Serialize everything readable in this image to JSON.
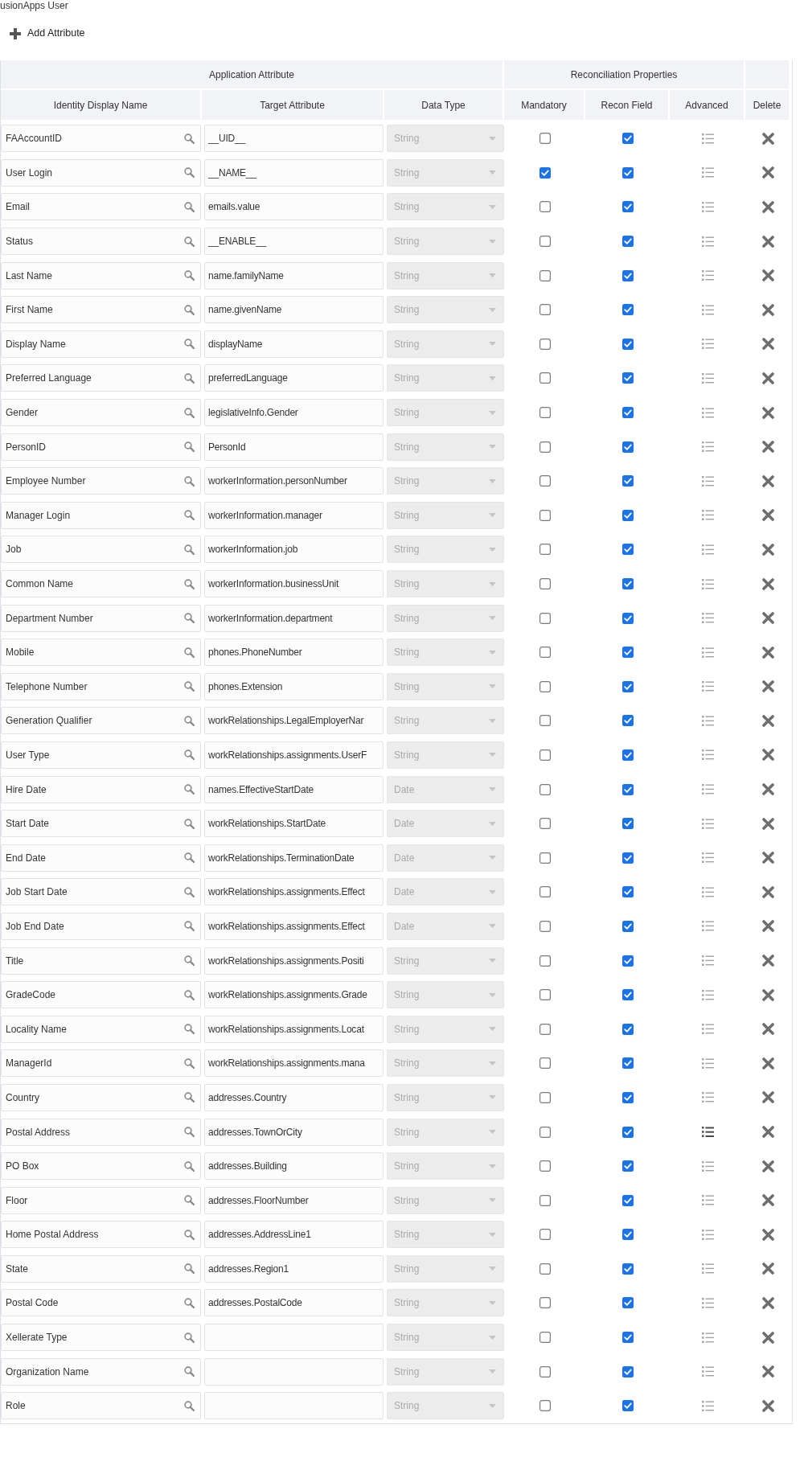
{
  "page": {
    "title": "usionApps User"
  },
  "toolbar": {
    "add_button": {
      "label": "Add Attribute"
    }
  },
  "table": {
    "groups": [
      {
        "label": "Application Attribute",
        "columns": [
          "Identity Display Name",
          "Target Attribute",
          "Data Type"
        ]
      },
      {
        "label": "Reconciliation Properties",
        "columns": [
          "Mandatory",
          "Recon Field",
          "Advanced"
        ]
      },
      {
        "columns": [
          "Delete"
        ]
      }
    ],
    "rows": [
      {
        "display_name": "FAAccountID",
        "target": "__UID__",
        "data_type": "String",
        "data_type_disabled": true,
        "mandatory": false,
        "recon_field": true,
        "advanced_highlighted": false
      },
      {
        "display_name": "User Login",
        "target": "__NAME__",
        "data_type": "String",
        "data_type_disabled": true,
        "mandatory": true,
        "recon_field": true,
        "advanced_highlighted": false
      },
      {
        "display_name": "Email",
        "target": "emails.value",
        "data_type": "String",
        "data_type_disabled": true,
        "mandatory": false,
        "recon_field": true,
        "advanced_highlighted": false
      },
      {
        "display_name": "Status",
        "target": "__ENABLE__",
        "data_type": "String",
        "data_type_disabled": true,
        "mandatory": false,
        "recon_field": true,
        "advanced_highlighted": false
      },
      {
        "display_name": "Last Name",
        "target": "name.familyName",
        "data_type": "String",
        "data_type_disabled": true,
        "mandatory": false,
        "recon_field": true,
        "advanced_highlighted": false
      },
      {
        "display_name": "First Name",
        "target": "name.givenName",
        "data_type": "String",
        "data_type_disabled": true,
        "mandatory": false,
        "recon_field": true,
        "advanced_highlighted": false
      },
      {
        "display_name": "Display Name",
        "target": "displayName",
        "data_type": "String",
        "data_type_disabled": true,
        "mandatory": false,
        "recon_field": true,
        "advanced_highlighted": false
      },
      {
        "display_name": "Preferred Language",
        "target": "preferredLanguage",
        "data_type": "String",
        "data_type_disabled": true,
        "mandatory": false,
        "recon_field": true,
        "advanced_highlighted": false
      },
      {
        "display_name": "Gender",
        "target": "legislativeInfo.Gender",
        "data_type": "String",
        "data_type_disabled": true,
        "mandatory": false,
        "recon_field": true,
        "advanced_highlighted": false
      },
      {
        "display_name": "PersonID",
        "target": "PersonId",
        "data_type": "String",
        "data_type_disabled": true,
        "mandatory": false,
        "recon_field": true,
        "advanced_highlighted": false
      },
      {
        "display_name": "Employee Number",
        "target": "workerInformation.personNumber",
        "data_type": "String",
        "data_type_disabled": true,
        "mandatory": false,
        "recon_field": true,
        "advanced_highlighted": false
      },
      {
        "display_name": "Manager Login",
        "target": "workerInformation.manager",
        "data_type": "String",
        "data_type_disabled": true,
        "mandatory": false,
        "recon_field": true,
        "advanced_highlighted": false
      },
      {
        "display_name": "Job",
        "target": "workerInformation.job",
        "data_type": "String",
        "data_type_disabled": true,
        "mandatory": false,
        "recon_field": true,
        "advanced_highlighted": false
      },
      {
        "display_name": "Common Name",
        "target": "workerInformation.businessUnit",
        "data_type": "String",
        "data_type_disabled": true,
        "mandatory": false,
        "recon_field": true,
        "advanced_highlighted": false
      },
      {
        "display_name": "Department Number",
        "target": "workerInformation.department",
        "data_type": "String",
        "data_type_disabled": true,
        "mandatory": false,
        "recon_field": true,
        "advanced_highlighted": false
      },
      {
        "display_name": "Mobile",
        "target": "phones.PhoneNumber",
        "data_type": "String",
        "data_type_disabled": true,
        "mandatory": false,
        "recon_field": true,
        "advanced_highlighted": false
      },
      {
        "display_name": "Telephone Number",
        "target": "phones.Extension",
        "data_type": "String",
        "data_type_disabled": true,
        "mandatory": false,
        "recon_field": true,
        "advanced_highlighted": false
      },
      {
        "display_name": "Generation Qualifier",
        "target": "workRelationships.LegalEmployerNar",
        "data_type": "String",
        "data_type_disabled": true,
        "mandatory": false,
        "recon_field": true,
        "advanced_highlighted": false
      },
      {
        "display_name": "User Type",
        "target": "workRelationships.assignments.UserF",
        "data_type": "String",
        "data_type_disabled": true,
        "mandatory": false,
        "recon_field": true,
        "advanced_highlighted": false
      },
      {
        "display_name": "Hire Date",
        "target": "names.EffectiveStartDate",
        "data_type": "Date",
        "data_type_disabled": true,
        "mandatory": false,
        "recon_field": true,
        "advanced_highlighted": false
      },
      {
        "display_name": "Start Date",
        "target": "workRelationships.StartDate",
        "data_type": "Date",
        "data_type_disabled": true,
        "mandatory": false,
        "recon_field": true,
        "advanced_highlighted": false
      },
      {
        "display_name": "End Date",
        "target": "workRelationships.TerminationDate",
        "data_type": "Date",
        "data_type_disabled": true,
        "mandatory": false,
        "recon_field": true,
        "advanced_highlighted": false
      },
      {
        "display_name": "Job Start Date",
        "target": "workRelationships.assignments.Effect",
        "data_type": "Date",
        "data_type_disabled": true,
        "mandatory": false,
        "recon_field": true,
        "advanced_highlighted": false
      },
      {
        "display_name": "Job End Date",
        "target": "workRelationships.assignments.Effect",
        "data_type": "Date",
        "data_type_disabled": true,
        "mandatory": false,
        "recon_field": true,
        "advanced_highlighted": false
      },
      {
        "display_name": "Title",
        "target": "workRelationships.assignments.Positi",
        "data_type": "String",
        "data_type_disabled": true,
        "mandatory": false,
        "recon_field": true,
        "advanced_highlighted": false
      },
      {
        "display_name": "GradeCode",
        "target": "workRelationships.assignments.Grade",
        "data_type": "String",
        "data_type_disabled": true,
        "mandatory": false,
        "recon_field": true,
        "advanced_highlighted": false
      },
      {
        "display_name": "Locality Name",
        "target": "workRelationships.assignments.Locat",
        "data_type": "String",
        "data_type_disabled": true,
        "mandatory": false,
        "recon_field": true,
        "advanced_highlighted": false
      },
      {
        "display_name": "ManagerId",
        "target": "workRelationships.assignments.mana",
        "data_type": "String",
        "data_type_disabled": true,
        "mandatory": false,
        "recon_field": true,
        "advanced_highlighted": false
      },
      {
        "display_name": "Country",
        "target": "addresses.Country",
        "data_type": "String",
        "data_type_disabled": true,
        "mandatory": false,
        "recon_field": true,
        "advanced_highlighted": false
      },
      {
        "display_name": "Postal Address",
        "target": "addresses.TownOrCity",
        "data_type": "String",
        "data_type_disabled": true,
        "mandatory": false,
        "recon_field": true,
        "advanced_highlighted": true
      },
      {
        "display_name": "PO Box",
        "target": "addresses.Building",
        "data_type": "String",
        "data_type_disabled": true,
        "mandatory": false,
        "recon_field": true,
        "advanced_highlighted": false
      },
      {
        "display_name": "Floor",
        "target": "addresses.FloorNumber",
        "data_type": "String",
        "data_type_disabled": true,
        "mandatory": false,
        "recon_field": true,
        "advanced_highlighted": false
      },
      {
        "display_name": "Home Postal Address",
        "target": "addresses.AddressLine1",
        "data_type": "String",
        "data_type_disabled": true,
        "mandatory": false,
        "recon_field": true,
        "advanced_highlighted": false
      },
      {
        "display_name": "State",
        "target": "addresses.Region1",
        "data_type": "String",
        "data_type_disabled": true,
        "mandatory": false,
        "recon_field": true,
        "advanced_highlighted": false
      },
      {
        "display_name": "Postal Code",
        "target": "addresses.PostalCode",
        "data_type": "String",
        "data_type_disabled": true,
        "mandatory": false,
        "recon_field": true,
        "advanced_highlighted": false
      },
      {
        "display_name": "Xellerate Type",
        "data_type": "String",
        "data_type_disabled": true,
        "mandatory": false,
        "recon_field": true,
        "advanced_highlighted": false
      },
      {
        "display_name": "Organization Name",
        "data_type": "String",
        "data_type_disabled": true,
        "mandatory": false,
        "recon_field": true,
        "advanced_highlighted": false
      },
      {
        "display_name": "Role",
        "data_type": "String",
        "data_type_disabled": true,
        "mandatory": false,
        "recon_field": true,
        "advanced_highlighted": false
      }
    ]
  }
}
